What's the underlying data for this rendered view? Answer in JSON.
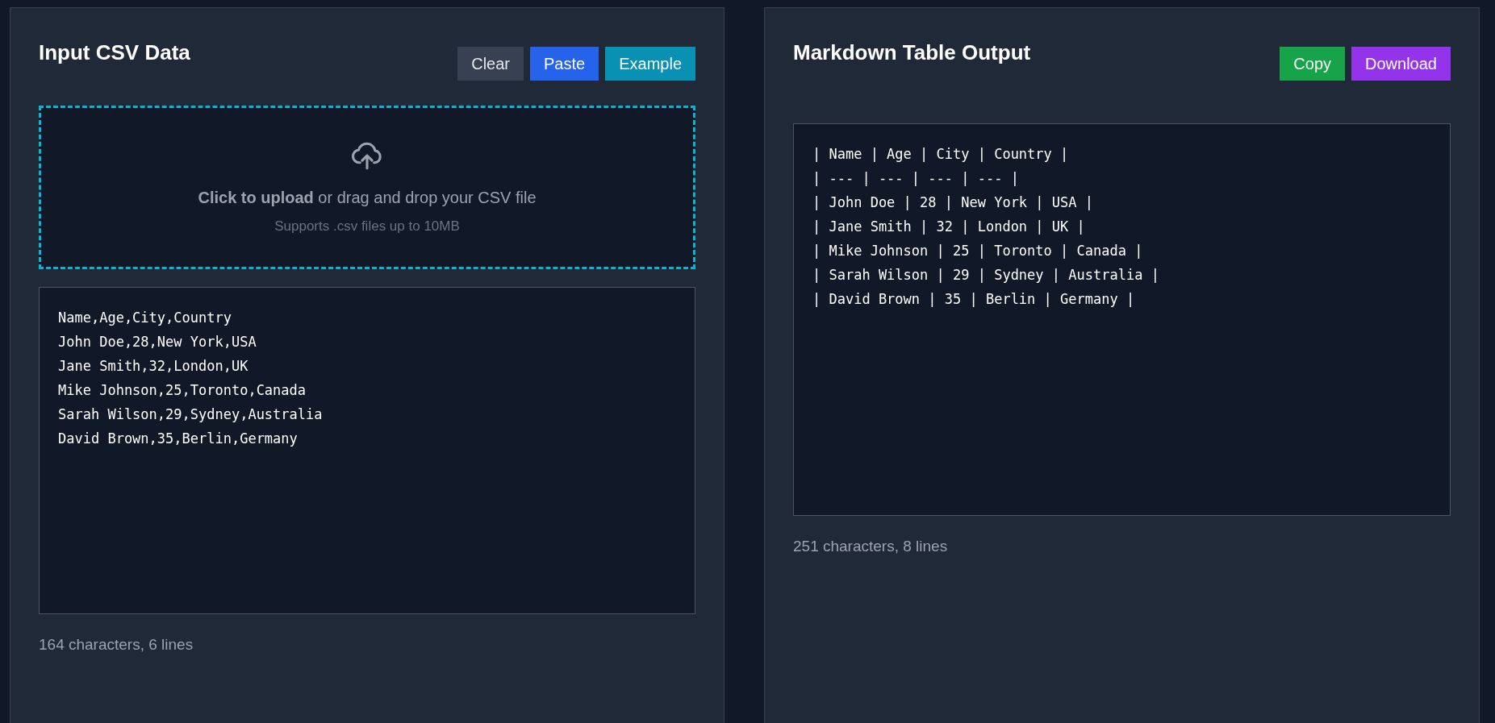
{
  "input_panel": {
    "title": "Input CSV Data",
    "buttons": [
      {
        "label": "Clear",
        "kind": "secondary"
      },
      {
        "label": "Paste",
        "kind": "primary"
      },
      {
        "label": "Example",
        "kind": "info"
      }
    ],
    "upload": {
      "prompt": "**Click to upload** or drag and drop your CSV file",
      "hint": "Supports .csv files up to 10MB"
    },
    "text": "Name,Age,City,Country\nJohn Doe,28,New York,USA\nJane Smith,32,London,UK\nMike Johnson,25,Toronto,Canada\nSarah Wilson,29,Sydney,Australia\nDavid Brown,35,Berlin,Germany",
    "stats": "164 characters, 6 lines"
  },
  "output_panel": {
    "title": "Markdown Table Output",
    "buttons": [
      {
        "label": "Copy",
        "kind": "success"
      },
      {
        "label": "Download",
        "kind": "purple"
      }
    ],
    "text": "| Name | Age | City | Country |\n| --- | --- | --- | --- |\n| John Doe | 28 | New York | USA |\n| Jane Smith | 32 | London | UK |\n| Mike Johnson | 25 | Toronto | Canada |\n| Sarah Wilson | 29 | Sydney | Australia |\n| David Brown | 35 | Berlin | Germany |",
    "stats": "251 characters, 8 lines"
  }
}
